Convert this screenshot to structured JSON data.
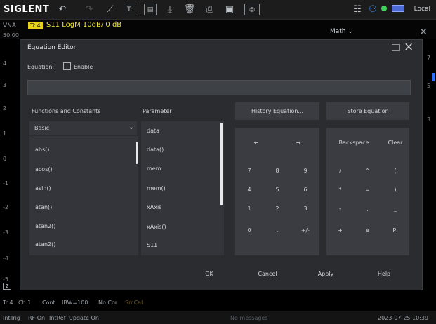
{
  "topbar": {
    "logo": "SIGLENT",
    "local": "Local",
    "icons": [
      "undo-icon",
      "redo-icon",
      "marker-icon",
      "trace-icon",
      "display-icon",
      "download-icon",
      "delete-icon",
      "print-icon",
      "save-icon",
      "camera-icon",
      "layout-icon",
      "network-icon",
      "status-icon",
      "battery-icon"
    ]
  },
  "traceline": {
    "vna": "VNA",
    "trace_badge": "Tr 4",
    "trace_text": "S11 LogM 10dB/ 0 dB",
    "math_dropdown": "Math ⌄"
  },
  "grid_labels": [
    "50.00",
    "4",
    "3",
    "2",
    "1",
    "0",
    "-1",
    "-2",
    "-3",
    "-4",
    "-5"
  ],
  "right_grid_labels": [
    "7",
    "5",
    "3"
  ],
  "marker_box": "2",
  "dialog": {
    "title": "Equation Editor",
    "equation_label": "Equation:",
    "enable_label": "Enable",
    "equation_value": "",
    "functions_header": "Functions and Constants",
    "parameter_header": "Parameter",
    "category_selected": "Basic",
    "functions": [
      "abs()",
      "acos()",
      "asin()",
      "atan()",
      "atan2()",
      "atan2()"
    ],
    "parameters": [
      "data",
      "data()",
      "mem",
      "mem()",
      "xAxis",
      "xAxis()",
      "S11"
    ],
    "history_button": "History Equation...",
    "store_button": "Store Equation",
    "nav_keys": [
      "←",
      "→"
    ],
    "edit_keys": [
      "Backspace",
      "Clear"
    ],
    "digit_rows": [
      [
        "7",
        "8",
        "9"
      ],
      [
        "4",
        "5",
        "6"
      ],
      [
        "1",
        "2",
        "3"
      ],
      [
        "0",
        ".",
        "+/-"
      ]
    ],
    "op_rows": [
      [
        "/",
        "^",
        "("
      ],
      [
        "*",
        "=",
        ")"
      ],
      [
        "-",
        ",",
        "_"
      ],
      [
        "+",
        "e",
        "PI"
      ]
    ],
    "ok": "OK",
    "cancel": "Cancel",
    "apply": "Apply",
    "help": "Help"
  },
  "status1": [
    "Tr 4",
    "Ch 1",
    "Cont",
    "IBW=100",
    "No Cor",
    "SrcCal"
  ],
  "status2": {
    "items": [
      "IntTrig",
      "RF On",
      "IntRef",
      "Update On"
    ],
    "message": "No messages",
    "datetime": "2023-07-25 10:39"
  }
}
